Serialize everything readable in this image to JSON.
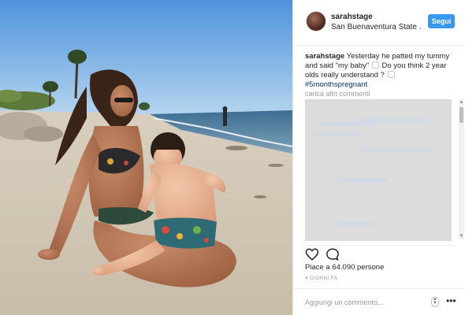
{
  "post": {
    "username": "sarahstage",
    "location": "San Buenaventura State ...",
    "follow_label": "Segui",
    "caption": {
      "user": "sarahstage",
      "text_1": "Yesterday he patted my tummy and said \"my baby\"",
      "text_2": "Do you think 2 year olds really understand ?",
      "hashtag": "#5monthspregnant"
    },
    "load_more_label": "carica altri commenti",
    "likes_text": "Piace a 64.090 persone",
    "timestamp": "4 GIORNI FA",
    "comment_placeholder": "Aggiungi un commento...",
    "more_label": "•••"
  },
  "icons": {
    "like": "heart-icon",
    "comment": "comment-bubble-icon",
    "more": "ellipsis-icon",
    "avatar": "profile-avatar"
  },
  "colors": {
    "follow_button": "#3897f0",
    "hashtag": "#003569",
    "muted_text": "#999999"
  }
}
